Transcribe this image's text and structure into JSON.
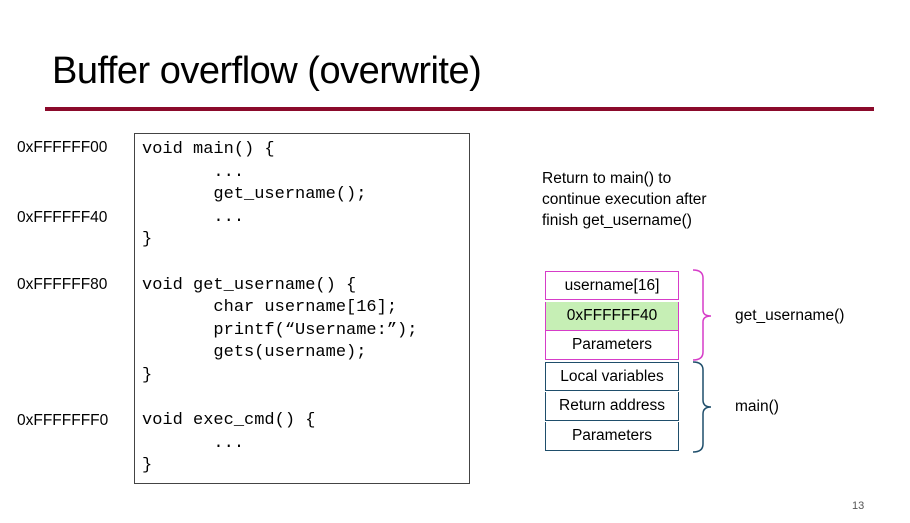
{
  "slide": {
    "title": "Buffer overflow (overwrite)",
    "page_number": "13",
    "accent_color": "#8b0a2b"
  },
  "addresses": [
    "0xFFFFFF00",
    "0xFFFFFF40",
    "0xFFFFFF80",
    "0xFFFFFFF0"
  ],
  "code": {
    "lines": [
      "void main() {",
      "       ...",
      "       get_username();",
      "       ...",
      "}",
      "void get_username() {",
      "       char username[16];",
      "       printf(“Username:”);",
      "       gets(username);",
      "}",
      "void exec_cmd() {",
      "       ...",
      "}"
    ]
  },
  "note": {
    "lines": [
      "Return to main() to",
      "continue execution after",
      "finish get_username()"
    ]
  },
  "stack": {
    "cells": [
      {
        "label": "username[16]",
        "frame": "get_username"
      },
      {
        "label": "0xFFFFFF40",
        "frame": "get_username",
        "highlight": "#c6efb5"
      },
      {
        "label": "Parameters",
        "frame": "get_username"
      },
      {
        "label": "Local variables",
        "frame": "main"
      },
      {
        "label": "Return address",
        "frame": "main"
      },
      {
        "label": "Parameters",
        "frame": "main"
      }
    ],
    "frames": {
      "get_username": {
        "label": "get_username()",
        "color": "#d63cc8"
      },
      "main": {
        "label": "main()",
        "color": "#1f4e6b"
      }
    }
  }
}
